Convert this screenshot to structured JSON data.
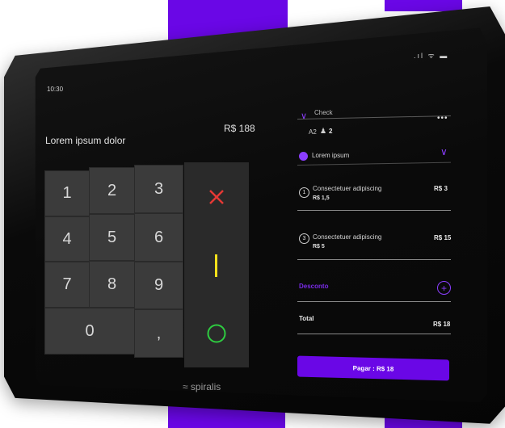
{
  "status_bar": {
    "time": "10:30",
    "icons": ".ıl ᯤ ▬"
  },
  "product": {
    "title": "Lorem ipsum dolor",
    "price": "R$ 188"
  },
  "keypad": {
    "digits": [
      "1",
      "2",
      "3",
      "4",
      "5",
      "6",
      "7",
      "8",
      "9",
      "0",
      ","
    ],
    "cancel_icon": "x-icon",
    "clear_icon": "bar-icon",
    "confirm_icon": "circle-icon",
    "colors": {
      "cancel": "#e53935",
      "clear": "#f5e11b",
      "confirm": "#2ecc40"
    }
  },
  "order": {
    "check_label": "Check",
    "table": "A2",
    "guests": "2",
    "customer": "Lorem ipsum",
    "items": [
      {
        "qty": "1",
        "name": "Consectetuer adipiscing",
        "unit_price": "R$ 1,5",
        "price": "R$ 3"
      },
      {
        "qty": "3",
        "name": "Consectetuer adipiscing",
        "unit_price": "R$ 5",
        "price": "R$ 15"
      }
    ],
    "discount_label": "Desconto",
    "total_label": "Total",
    "total_value": "R$ 18",
    "pay_button": "Pagar : R$ 18"
  },
  "brand": {
    "logo_text": "spiralis",
    "accent": "#6a07e6"
  }
}
